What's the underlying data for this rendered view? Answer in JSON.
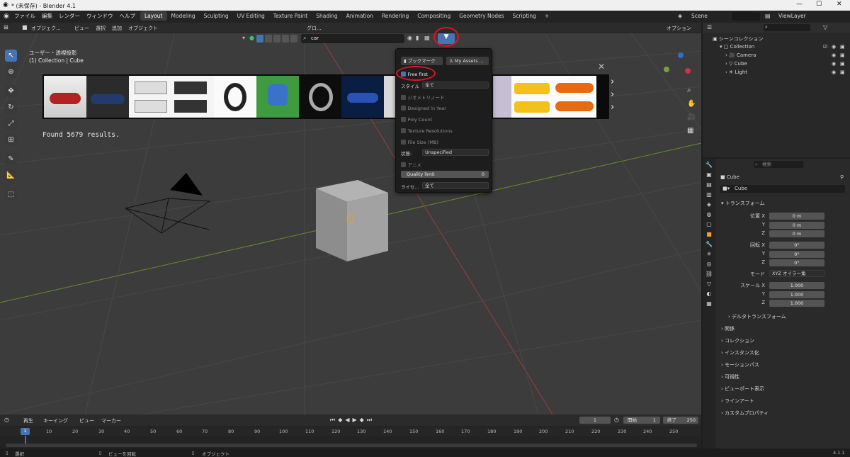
{
  "window": {
    "title": "* (未保存) - Blender 4.1",
    "version": "4.1.1"
  },
  "menu": {
    "items": [
      "ファイル",
      "編集",
      "レンダー",
      "ウィンドウ",
      "ヘルプ"
    ]
  },
  "workspaces": {
    "tabs": [
      "Layout",
      "Modeling",
      "Sculpting",
      "UV Editing",
      "Texture Paint",
      "Shading",
      "Animation",
      "Rendering",
      "Compositing",
      "Geometry Nodes",
      "Scripting"
    ],
    "active": "Layout",
    "add": "+"
  },
  "scene": {
    "scene_name": "Scene",
    "view_layer": "ViewLayer"
  },
  "viewport": {
    "header": {
      "mode": "オブジェク...",
      "view": "ビュー",
      "select": "選択",
      "add": "追加",
      "object": "オブジェクト",
      "orientation": "グロ...",
      "options": "オプション"
    },
    "overlay_text": {
      "view_name": "ユーザー・透視投影",
      "collection": "(1) Collection | Cube"
    },
    "search": {
      "value": "car",
      "placeholder": "検索"
    },
    "found_text": "Found 5679 results."
  },
  "filter_popup": {
    "bookmark_label": "ブックマーク",
    "my_assets_label": "My Assets ...",
    "free_first_label": "Free first",
    "style_label": "スタイル",
    "style_value": "全て",
    "geometry_nodes_label": "ジオメトリノード",
    "designed_in_year_label": "Designed in Year",
    "poly_count_label": "Poly Count",
    "texture_res_label": "Texture Resolutions",
    "file_size_label": "File Size (MB)",
    "condition_label": "状態:",
    "condition_value": "Unspecified",
    "anime_label": "アニメ",
    "quality_label": "Quality limit",
    "quality_value": "0",
    "license_label": "ライセ...",
    "license_value": "全て"
  },
  "outliner": {
    "title": "シーンコレクション",
    "search_placeholder": "",
    "items": [
      {
        "name": "Collection"
      },
      {
        "name": "Camera"
      },
      {
        "name": "Cube"
      },
      {
        "name": "Light"
      }
    ]
  },
  "properties": {
    "search_placeholder": "検索",
    "object_name": "Cube",
    "object_field": "Cube",
    "transform_title": "トランスフォーム",
    "location_label": "位置 X",
    "y_label": "Y",
    "z_label": "Z",
    "location": [
      "0 m",
      "0 m",
      "0 m"
    ],
    "rotation_label": "回転 X",
    "rotation": [
      "0°",
      "0°",
      "0°"
    ],
    "mode_label": "モード",
    "mode_value": "XYZ オイラー角",
    "scale_label": "スケール X",
    "scale": [
      "1.000",
      "1.000",
      "1.000"
    ],
    "delta_label": "デルタトランスフォーム",
    "sections": [
      "関係",
      "コレクション",
      "インスタンス化",
      "モーションパス",
      "可視性",
      "ビューポート表示",
      "ラインアート",
      "カスタムプロパティ"
    ]
  },
  "timeline": {
    "menu": [
      "再生",
      "キーイング",
      "ビュー",
      "マーカー"
    ],
    "current_frame": "1",
    "start_label": "開始",
    "start": "1",
    "end_label": "終了",
    "end": "250",
    "ticks": [
      "1",
      "10",
      "20",
      "30",
      "40",
      "50",
      "60",
      "70",
      "80",
      "90",
      "100",
      "110",
      "120",
      "130",
      "140",
      "150",
      "160",
      "170",
      "180",
      "190",
      "200",
      "210",
      "220",
      "230",
      "240",
      "250"
    ]
  },
  "status": {
    "select": "選択",
    "rotate": "ビューを回転",
    "object": "オブジェクト"
  },
  "colors": {
    "accent": "#4772b3",
    "highlight_circle": "#e0141e",
    "grid_red": "#9a3c3c",
    "grid_green": "#5f8a2a"
  }
}
